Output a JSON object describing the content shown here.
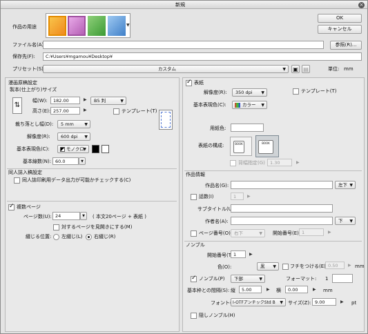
{
  "window": {
    "title": "新規"
  },
  "top": {
    "usage_label": "作品の用途",
    "ok": "OK",
    "cancel": "キャンセル",
    "filename_label": "ファイル名(A):",
    "filename_value": "",
    "browse": "参照(R)...",
    "savepath_label": "保存先(F):",
    "savepath_value": "C:¥Users¥mgamou¥Desktop¥",
    "preset_label": "プリセット(S):",
    "preset_value": "カスタム",
    "unit_label": "単位:",
    "unit_value": "mm"
  },
  "manga": {
    "section": "漫画原稿設定",
    "size_label": "製本(仕上がり)サイズ",
    "width_label": "幅(W):",
    "width_value": "182.00",
    "height_label": "高さ(E):",
    "height_value": "257.00",
    "size_preset": "B5 判",
    "template_label": "テンプレート(T)",
    "bleed_label": "裁ち落とし幅(D):",
    "bleed_value": "5 mm",
    "dpi_label": "解像度(R):",
    "dpi_value": "600 dpi",
    "color_label": "基本表現色(C):",
    "color_value": "モノクロ",
    "lines_label": "基本線数(N):",
    "lines_value": "60.0"
  },
  "doujin": {
    "section": "同人誌入稿設定",
    "check_label": "同人誌印刷用データ出力が可能かチェックする(C)"
  },
  "multipage": {
    "label": "複数ページ",
    "pages_label": "ページ数(U):",
    "pages_value": "24",
    "pages_note": "( 本文20ページ + 表紙 )",
    "spread_label": "対するページを見開きにする(M)",
    "binding_label": "綴じる位置:",
    "left_label": "左綴じ(L)",
    "right_label": "右綴じ(R)"
  },
  "cover": {
    "label": "表紙",
    "dpi_label": "解像度(R):",
    "dpi_value": "350 dpi",
    "template_label": "テンプレート(T)",
    "color_label": "基本表現色(C):",
    "color_value": "カラー",
    "paper_label": "用紙色:",
    "layout_label": "表紙の構成:",
    "spine_label": "背幅指定(G)",
    "spine_value": "1.30"
  },
  "work": {
    "section": "作品情報",
    "title_label": "作品名(G):",
    "title_value": "",
    "title_pos": "左下",
    "episode_label": "話数(I)",
    "episode_value": "1",
    "subtitle_label": "サブタイトル(U):",
    "subtitle_value": "",
    "author_label": "作者名(A):",
    "author_value": "",
    "author_pos": "下",
    "pagenum_label": "ページ番号(O)",
    "pagenum_pos": "右下",
    "startnum_label": "開始番号(E):",
    "startnum_value": "1"
  },
  "nombre": {
    "section": "ノンブル",
    "start_label": "開始番号(T):",
    "start_value": "1",
    "color_label": "色(O):",
    "color_value": "黒",
    "edge_label": "フチをつける(E)",
    "edge_value": "0.50",
    "mm": "mm",
    "nombre_label": "ノンブル(P)",
    "nombre_pos": "下部",
    "format_label": "フォーマット:",
    "format_value": "1",
    "gap_label": "基本枠との間隔(S):",
    "vert_label": "縦",
    "vert_value": "5.00",
    "horiz_label": "横",
    "horiz_value": "0.00",
    "font_label": "フォント(F):",
    "font_value": "I-OTFアンチックStd B",
    "size_label": "サイズ(Z):",
    "size_value": "9.00",
    "pt": "pt",
    "hidden_label": "隠しノンブル(H)"
  }
}
